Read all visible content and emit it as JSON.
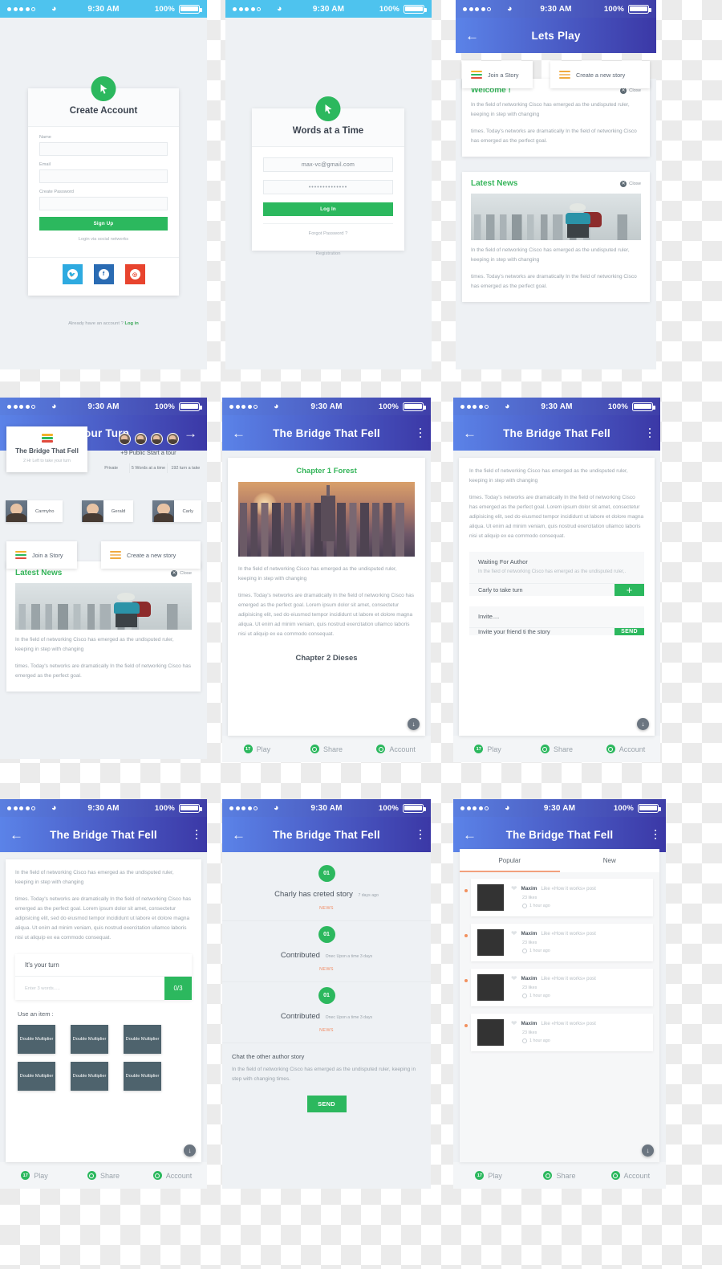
{
  "status_bar": {
    "time": "9:30 AM",
    "battery": "100%",
    "signal_dots": 5,
    "signal_filled": 4
  },
  "common": {
    "back_arrow": "←",
    "forward_arrow": "→",
    "close_label": "Close",
    "paragraph_1": "In the field of networking Cisco has emerged as the  undisputed ruler, keeping in step with changing",
    "paragraph_2": "times. Today's networks are dramatically In the field of networking Cisco has emerged as the perfect goal.",
    "paragraph_long": "times. Today's networks are dramatically In the field of networking Cisco has emerged as the perfect goal. Lorem ipsum dolor sit amet, consectetur adipisicing elit, sed do eiusmod tempor incididunt ut labore et dolore magna aliqua. Ut enim ad minim veniam, quis nostrud exercitation ullamco laboris nisi ut aliquip ex ea commodo consequat.",
    "join_story": "Join a Story",
    "create_story": "Create a new story",
    "latest_news": "Latest News",
    "tabbar": [
      {
        "label": "Play",
        "icon": "play-badge-icon",
        "badge": "17"
      },
      {
        "label": "Share",
        "icon": "share-icon",
        "badge": ""
      },
      {
        "label": "Account",
        "icon": "account-icon",
        "badge": ""
      }
    ],
    "scroll_down_icon": "↓"
  },
  "screen1": {
    "title": "Create Account",
    "logo_icon": "cursor-arrow-icon",
    "fields": [
      {
        "label": "Name",
        "value": "",
        "placeholder": ""
      },
      {
        "label": "Email",
        "value": "",
        "placeholder": ""
      },
      {
        "label": "Create Password",
        "value": "",
        "placeholder": ""
      }
    ],
    "signup_button": "Sign Up",
    "social_label": "Login via social networks",
    "socials": [
      {
        "name": "twitter",
        "color": "#2eaae0",
        "glyph": "twitter-icon"
      },
      {
        "name": "facebook",
        "color": "#2a6bb3",
        "glyph": "facebook-icon"
      },
      {
        "name": "pinterest",
        "color": "#e8442e",
        "glyph": "pinterest-icon"
      }
    ],
    "footer_text": "Already have an account ?",
    "footer_link": "Log in"
  },
  "screen2": {
    "title": "Words at a Time",
    "logo_icon": "cursor-arrow-icon",
    "email_value": "max-vc@gmail.com",
    "password_value": "••••••••••••••",
    "login_button": "Log In",
    "forgot_link": "Forgot Password ?",
    "registration_link": "Registration"
  },
  "screen3": {
    "title": "Lets Play",
    "welcome_title": "Welcome !",
    "news_title": "Latest News",
    "news_image": "hiker-city-photo"
  },
  "screen4": {
    "title": "Your Turn",
    "story_title": "The Bridge That Fell",
    "story_sub": "2 Hr Left to take your turn",
    "story_icon": "stack-icon",
    "public_text": "+9 Public Start a tour",
    "meta": [
      "Private",
      "5 Words at a time",
      "192 turn a take"
    ],
    "avatar_count": 4,
    "people": [
      "Carmyho",
      "Gerald",
      "Carly"
    ],
    "news_title": "Latest News"
  },
  "screen5": {
    "title": "The Bridge That Fell",
    "chapter1": "Chapter 1 Forest",
    "chapter2": "Chapter 2 Dieses",
    "chapter_image": "city-skyline-sunset-photo"
  },
  "screen6": {
    "title": "The Bridge That Fell",
    "waiting_title": "Waiting For Author",
    "waiting_desc": "In the field of networking Cisco has emerged as the undisputed ruler,.",
    "turn_row": "Carly to take turn",
    "turn_action": "+",
    "invite_title": "Invite....",
    "invite_row": "Invite your friend ti the story",
    "invite_action": "SEND"
  },
  "screen7": {
    "title": "The Bridge That Fell",
    "turn_header": "It's your turn",
    "input_placeholder": "Enter 3 words.....",
    "counter": "0/3",
    "use_item_label": "Use an item :",
    "items": [
      "Double Multiplier",
      "Double Multiplier",
      "Double Multiplier",
      "Double Multiplier",
      "Double Multiplier",
      "Double Multiplier"
    ]
  },
  "screen8": {
    "title": "The Bridge That Fell",
    "feed": [
      {
        "badge": "01",
        "text": "Charly has creted story",
        "meta": "7 days ago",
        "tag": "NEWS"
      },
      {
        "badge": "01",
        "text": "Contributed",
        "meta": "Onec Upon a time 3 days",
        "tag": "NEWS"
      },
      {
        "badge": "01",
        "text": "Contributed",
        "meta": "Onec Upon a time 3 days",
        "tag": "NEWS"
      }
    ],
    "chat_title": "Chat the other author story",
    "chat_text": "In the field of networking Cisco has emerged as the undisputed ruler, keeping in step with changing times.",
    "send_button": "SEND"
  },
  "screen9": {
    "title": "The Bridge That Fell",
    "tabs": [
      {
        "label": "Popular",
        "active": true
      },
      {
        "label": "New",
        "active": false
      }
    ],
    "posts": [
      {
        "user": "Maxim",
        "action": "Like «How it works» post",
        "likes": "23 likes",
        "time": "1 hour ago"
      },
      {
        "user": "Maxim",
        "action": "Like «How it works» post",
        "likes": "23 likes",
        "time": "1 hour ago"
      },
      {
        "user": "Maxim",
        "action": "Like «How it works» post",
        "likes": "23 likes",
        "time": "1 hour ago"
      },
      {
        "user": "Maxim",
        "action": "Like «How it works» post",
        "likes": "23 likes",
        "time": "1 hour ago"
      }
    ]
  }
}
